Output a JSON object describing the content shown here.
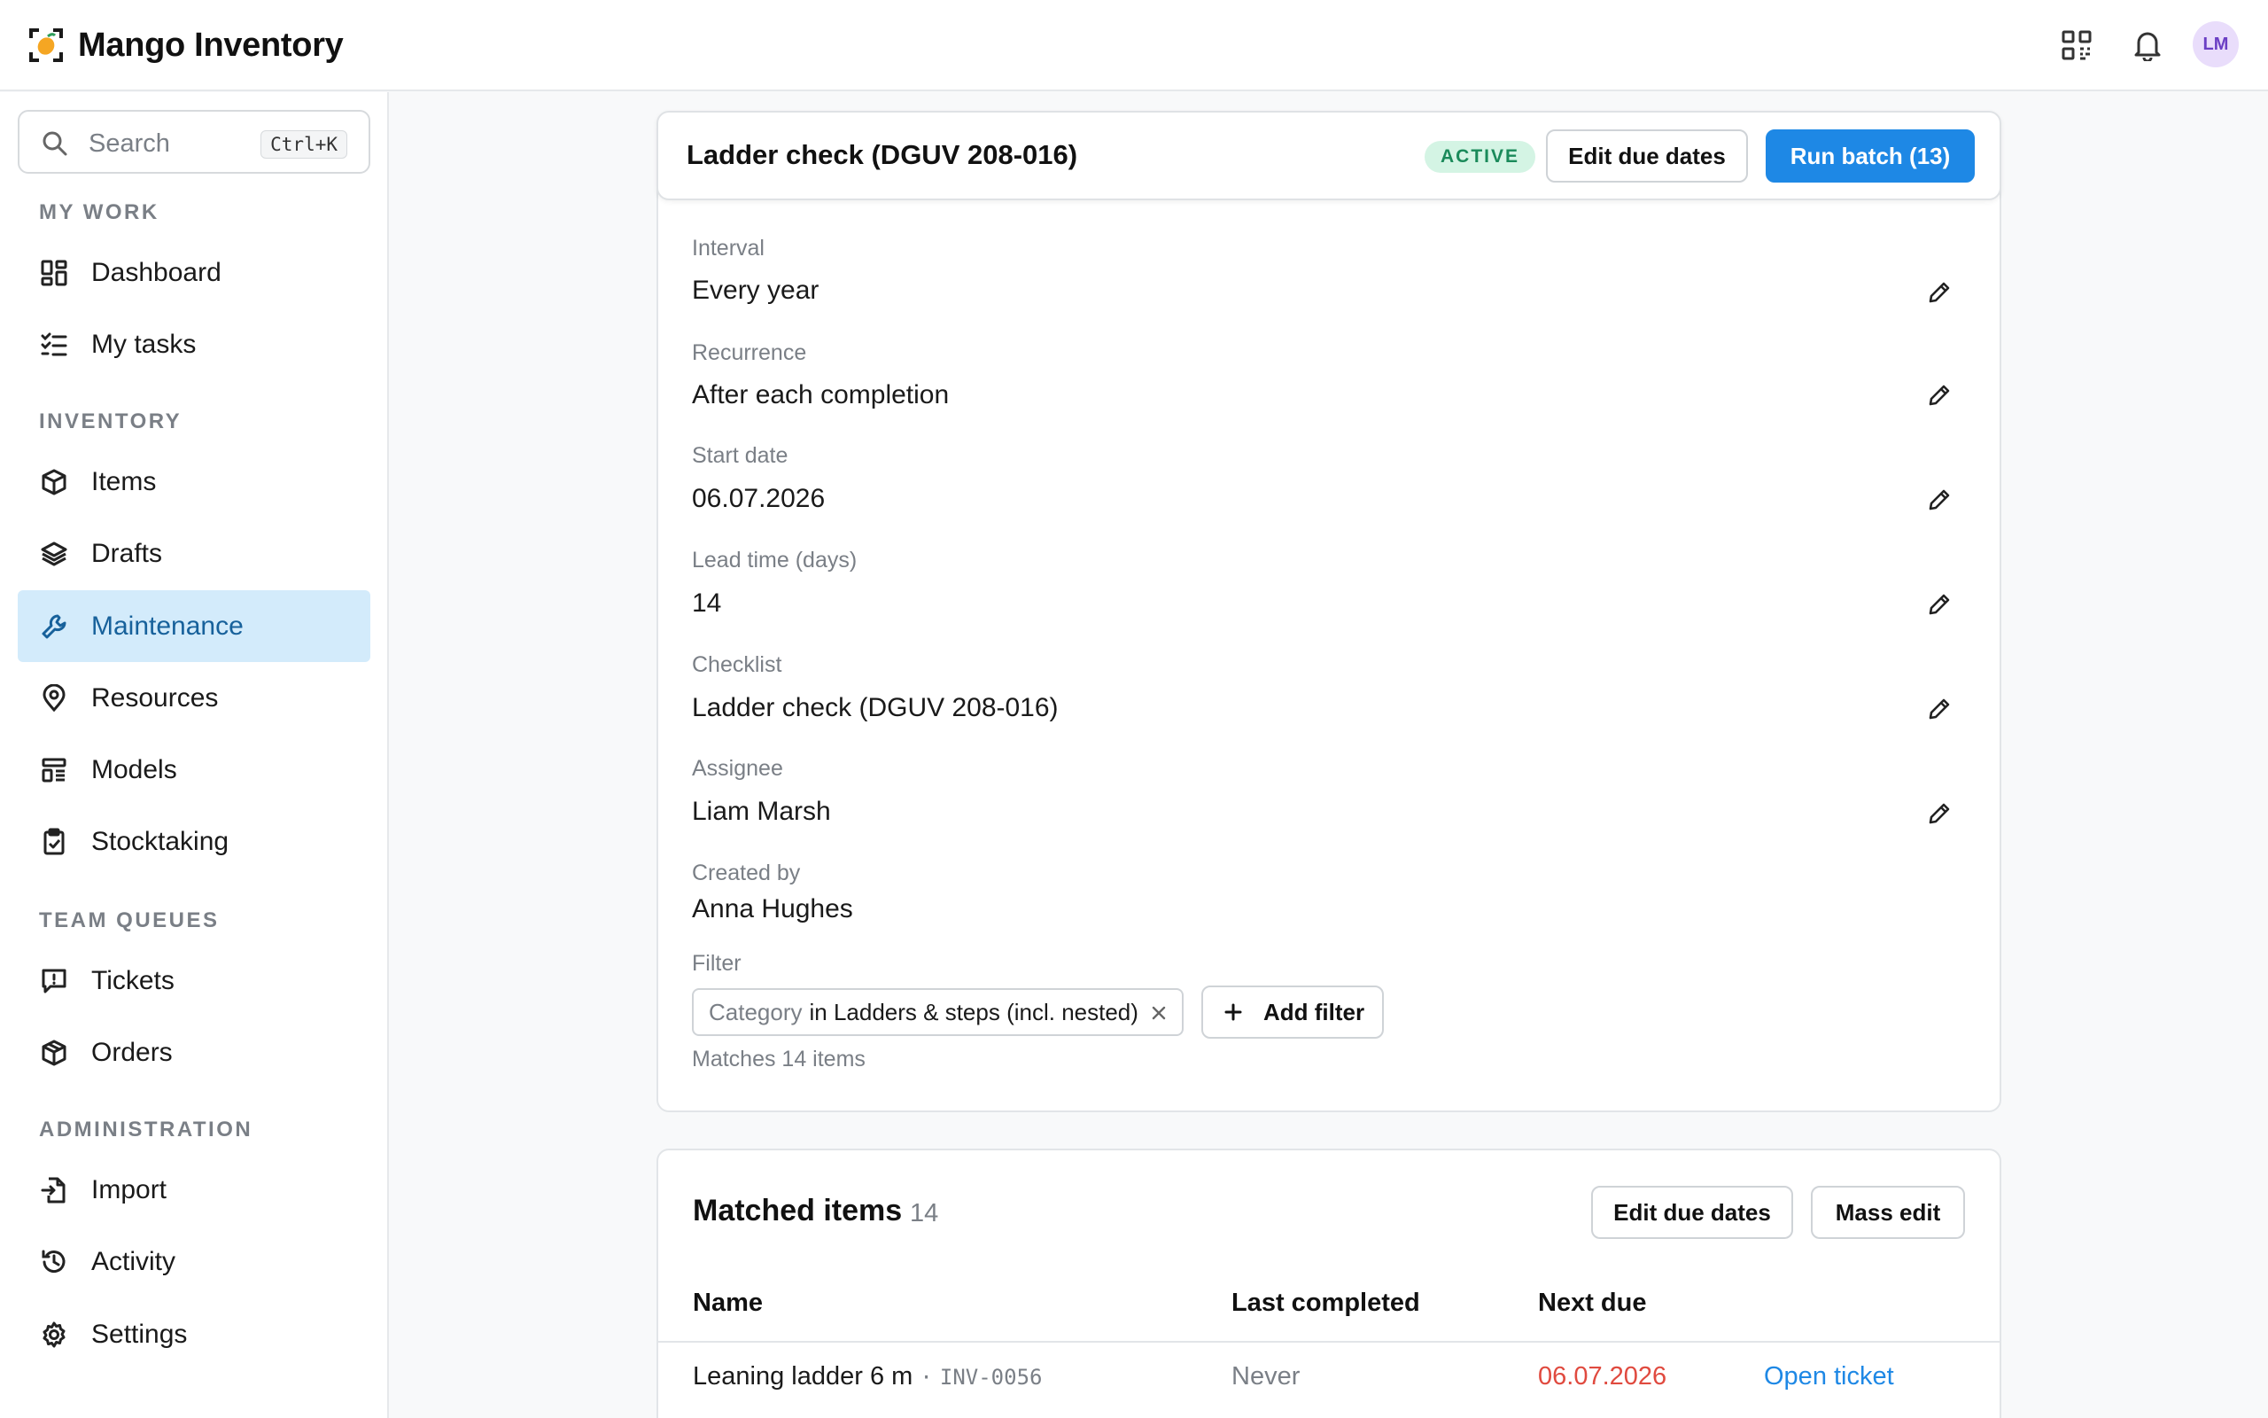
{
  "app": {
    "title": "Mango Inventory",
    "user_initials": "LM"
  },
  "search": {
    "placeholder": "Search",
    "shortcut": "Ctrl+K"
  },
  "sidebar": {
    "sections": [
      {
        "label": "MY WORK"
      },
      {
        "label": "INVENTORY"
      },
      {
        "label": "TEAM QUEUES"
      },
      {
        "label": "ADMINISTRATION"
      }
    ],
    "items": [
      {
        "label": "Dashboard",
        "icon": "dashboard-icon"
      },
      {
        "label": "My tasks",
        "icon": "tasks-icon"
      },
      {
        "label": "Items",
        "icon": "cube-icon"
      },
      {
        "label": "Drafts",
        "icon": "layers-icon"
      },
      {
        "label": "Maintenance",
        "icon": "wrench-icon",
        "active": true
      },
      {
        "label": "Resources",
        "icon": "location-pin-icon"
      },
      {
        "label": "Models",
        "icon": "models-icon"
      },
      {
        "label": "Stocktaking",
        "icon": "clipboard-check-icon"
      },
      {
        "label": "Tickets",
        "icon": "ticket-icon"
      },
      {
        "label": "Orders",
        "icon": "box-icon"
      },
      {
        "label": "Import",
        "icon": "import-icon"
      },
      {
        "label": "Activity",
        "icon": "history-icon"
      },
      {
        "label": "Settings",
        "icon": "gear-icon"
      }
    ]
  },
  "plan": {
    "title": "Ladder check (DGUV 208-016)",
    "status": "ACTIVE",
    "edit_due_dates_label": "Edit due dates",
    "run_batch_label": "Run batch (13)",
    "fields": [
      {
        "label": "Interval",
        "value": "Every year",
        "editable": true
      },
      {
        "label": "Recurrence",
        "value": "After each completion",
        "editable": true
      },
      {
        "label": "Start date",
        "value": "06.07.2026",
        "editable": true
      },
      {
        "label": "Lead time (days)",
        "value": "14",
        "editable": true
      },
      {
        "label": "Checklist",
        "value": "Ladder check (DGUV 208-016)",
        "editable": true
      },
      {
        "label": "Assignee",
        "value": "Liam Marsh",
        "editable": true
      },
      {
        "label": "Created by",
        "value": "Anna Hughes",
        "editable": false
      }
    ],
    "filter": {
      "label": "Filter",
      "chip_key": "Category",
      "chip_value": "in Ladders & steps (incl. nested)",
      "add_filter_label": "Add filter",
      "matches_text": "Matches 14 items"
    }
  },
  "matched": {
    "title": "Matched items",
    "count": "14",
    "edit_due_dates_label": "Edit due dates",
    "mass_edit_label": "Mass edit",
    "columns": [
      "Name",
      "Last completed",
      "Next due"
    ],
    "rows": [
      {
        "name": "Leaning ladder 6 m",
        "sep": "·",
        "inventory_no": "INV-0056",
        "last_completed": "Never",
        "next_due": "06.07.2026",
        "action": "Open ticket"
      }
    ]
  },
  "colors": {
    "accent": "#1e88e5",
    "active_nav_bg": "#d3ebfb",
    "active_badge_bg": "#d4f4e4",
    "overdue": "#e04a3f",
    "brand_orange": "#f5a623"
  }
}
